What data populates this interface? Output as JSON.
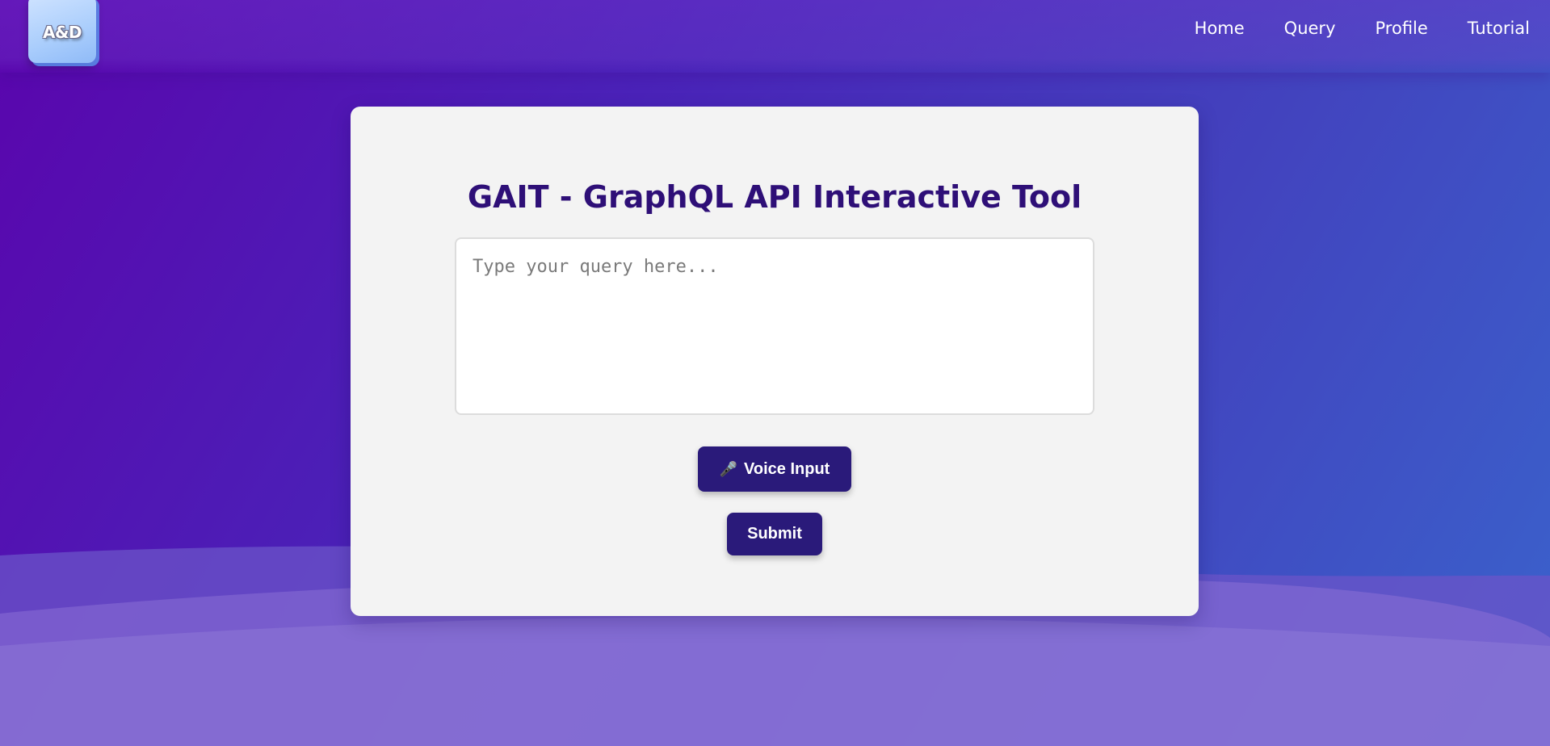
{
  "logo": {
    "text": "A&D"
  },
  "nav": {
    "items": [
      {
        "label": "Home"
      },
      {
        "label": "Query"
      },
      {
        "label": "Profile"
      },
      {
        "label": "Tutorial"
      }
    ]
  },
  "main": {
    "title": "GAIT - GraphQL API Interactive Tool",
    "query_placeholder": "Type your query here...",
    "query_value": "",
    "voice_button": {
      "icon": "microphone-icon",
      "glyph": "🎤",
      "label": "Voice Input"
    },
    "submit_label": "Submit"
  },
  "colors": {
    "title": "#2e0f77",
    "button": "#2a1a7a",
    "card": "#f3f3f3",
    "background_start": "#5a05ad",
    "background_end": "#3a63cc"
  }
}
